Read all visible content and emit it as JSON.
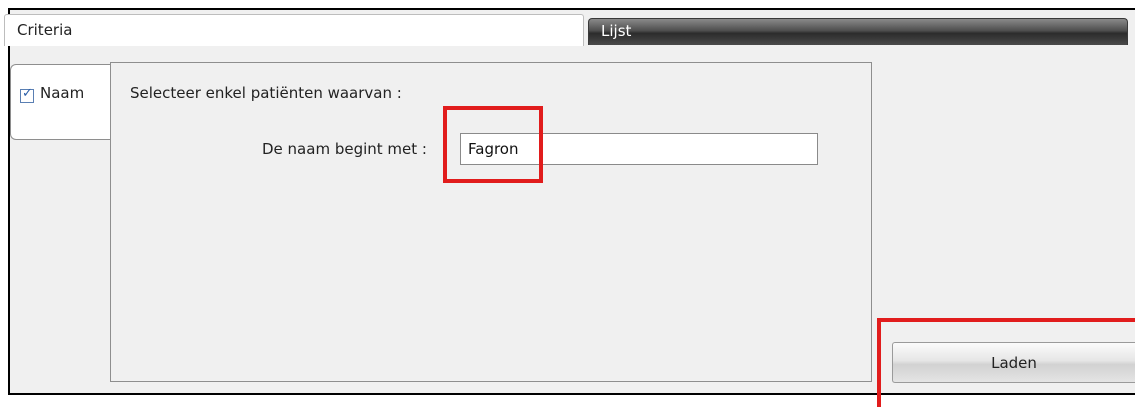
{
  "tabs": [
    {
      "label": "Criteria",
      "active": true
    },
    {
      "label": "Lijst",
      "active": false
    }
  ],
  "side_tab": {
    "label": "Naam",
    "checked": true
  },
  "panel": {
    "heading": "Selecteer enkel patiënten waarvan :",
    "field_label": "De naam begint met :",
    "field_value": "Fagron"
  },
  "buttons": {
    "load_label": "Laden"
  },
  "colors": {
    "highlight": "#e11c1c",
    "lijst_tab": "#3a3a3a",
    "checkbox": "#2a5ea8"
  }
}
